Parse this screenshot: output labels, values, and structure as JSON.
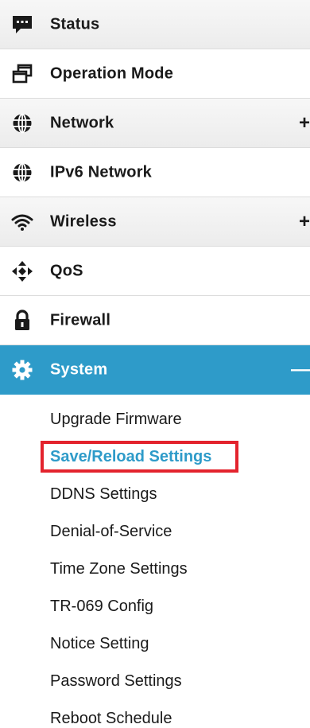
{
  "menu": {
    "items": [
      {
        "label": "Status",
        "icon": "chat-icon",
        "toggle": ""
      },
      {
        "label": "Operation Mode",
        "icon": "windows-icon",
        "toggle": ""
      },
      {
        "label": "Network",
        "icon": "globe-icon",
        "toggle": "+"
      },
      {
        "label": "IPv6 Network",
        "icon": "globe-icon",
        "toggle": ""
      },
      {
        "label": "Wireless",
        "icon": "wifi-icon",
        "toggle": "+"
      },
      {
        "label": "QoS",
        "icon": "arrows-icon",
        "toggle": ""
      },
      {
        "label": "Firewall",
        "icon": "lock-icon",
        "toggle": ""
      },
      {
        "label": "System",
        "icon": "gear-icon",
        "toggle": "—"
      }
    ],
    "active": "System",
    "accent_color": "#2e9bc9",
    "highlight_color": "#e3232d"
  },
  "system_submenu": {
    "items": [
      "Upgrade Firmware",
      "Save/Reload Settings",
      "DDNS Settings",
      "Denial-of-Service",
      "Time Zone Settings",
      "TR-069 Config",
      "Notice Setting",
      "Password Settings",
      "Reboot Schedule"
    ],
    "selected": "Save/Reload Settings"
  }
}
